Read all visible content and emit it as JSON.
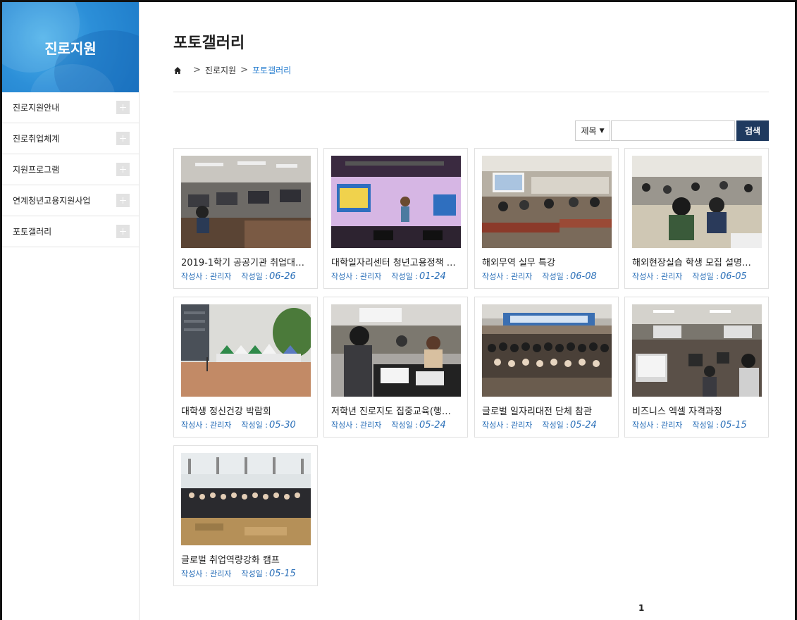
{
  "sidebar": {
    "title": "진로지원",
    "items": [
      {
        "label": "진로지원안내"
      },
      {
        "label": "진로취업체계"
      },
      {
        "label": "지원프로그램"
      },
      {
        "label": "연계청년고용지원사업"
      },
      {
        "label": "포토갤러리"
      }
    ]
  },
  "main": {
    "title": "포토갤러리",
    "breadcrumb": [
      "진로지원",
      "포토갤러리"
    ],
    "search": {
      "select_value": "제목",
      "input_value": "",
      "button_label": "검색"
    },
    "meta_labels": {
      "author": "작성사 : 관리자",
      "date": "작성일 :"
    },
    "posts": [
      {
        "title": "2019-1학기 공공기관 취업대…",
        "date": "06-26",
        "thumb": "hall-pc"
      },
      {
        "title": "대학일자리센터 청년고용정책 …",
        "date": "01-24",
        "thumb": "stage"
      },
      {
        "title": "해외무역 실무 특강",
        "date": "06-08",
        "thumb": "lecture"
      },
      {
        "title": "해외현장실습 학생 모집 설명…",
        "date": "06-05",
        "thumb": "seminar"
      },
      {
        "title": "대학생 정신건강 박람회",
        "date": "05-30",
        "thumb": "outdoor"
      },
      {
        "title": "저학년 진로지도 집중교육(행…",
        "date": "05-24",
        "thumb": "workshop"
      },
      {
        "title": "글로벌 일자리대전 단체 참관",
        "date": "05-24",
        "thumb": "group"
      },
      {
        "title": "비즈니스 엑셀 자격과정",
        "date": "05-15",
        "thumb": "computer"
      },
      {
        "title": "글로벌 취업역량강화 캠프",
        "date": "05-15",
        "thumb": "camp"
      }
    ],
    "pagination": {
      "current": "1"
    }
  }
}
